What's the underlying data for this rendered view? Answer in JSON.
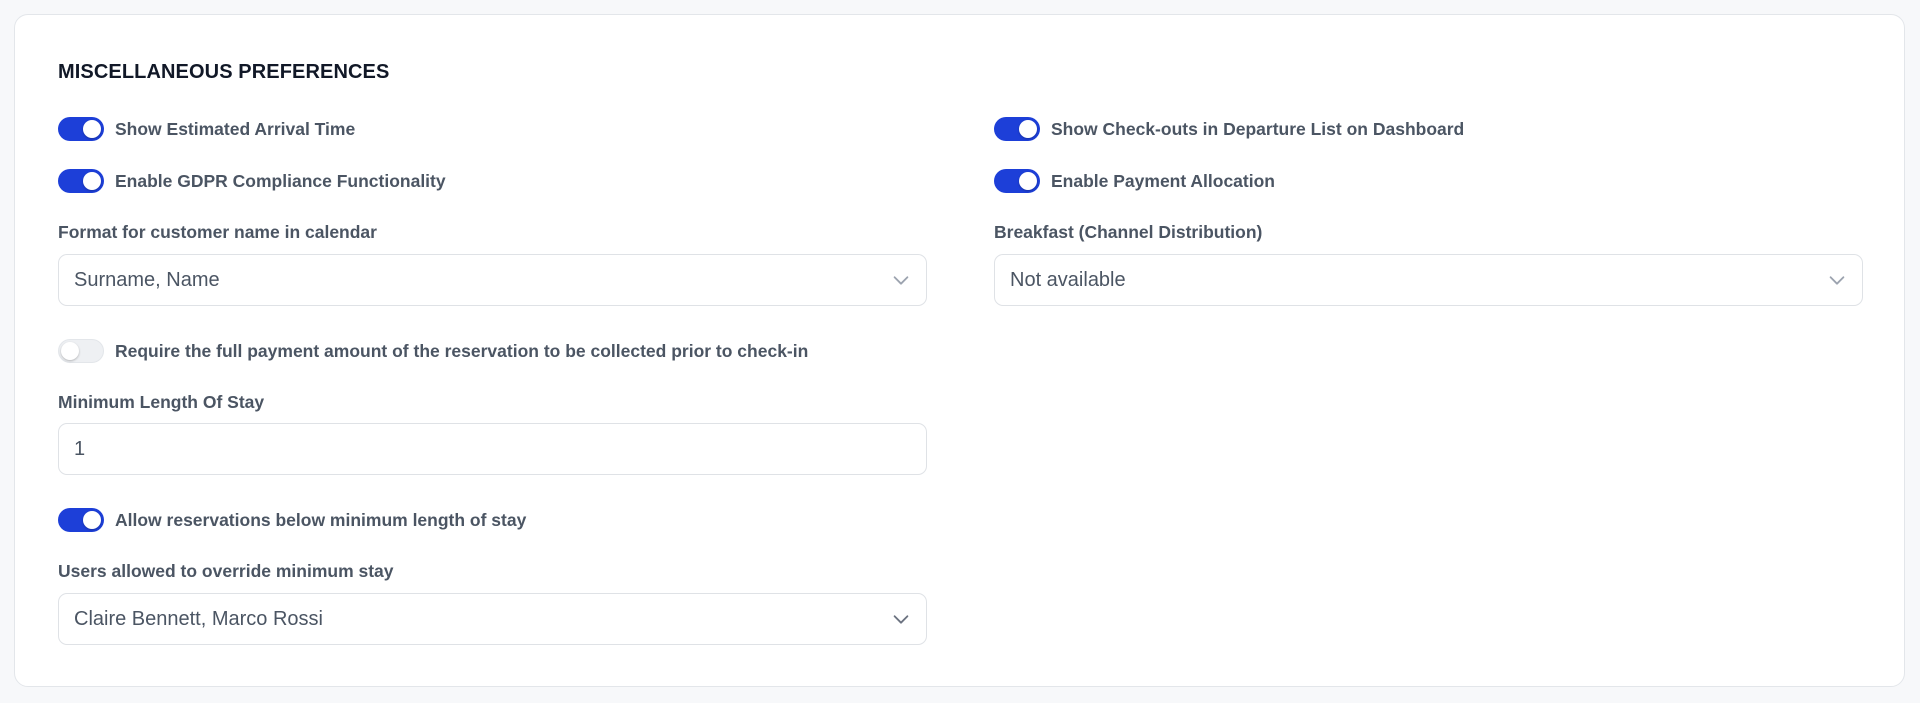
{
  "section": {
    "title": "MISCELLANEOUS PREFERENCES"
  },
  "toggles": {
    "estimated_arrival": {
      "label": "Show Estimated Arrival Time",
      "on": true
    },
    "checkouts_departure": {
      "label": "Show Check-outs in Departure List on Dashboard",
      "on": true
    },
    "gdpr": {
      "label": "Enable GDPR Compliance Functionality",
      "on": true
    },
    "payment_allocation": {
      "label": "Enable Payment Allocation",
      "on": true
    },
    "full_payment": {
      "label": "Require the full payment amount of the reservation to be collected prior to check-in",
      "on": false
    },
    "allow_below_min": {
      "label": "Allow reservations below minimum length of stay",
      "on": true
    }
  },
  "fields": {
    "customer_name_format": {
      "label": "Format for customer name in calendar",
      "value": "Surname, Name",
      "icon": "chevron-down-icon"
    },
    "breakfast": {
      "label": "Breakfast (Channel Distribution)",
      "value": "Not available",
      "icon": "chevron-down-icon"
    },
    "min_length_of_stay": {
      "label": "Minimum Length Of Stay",
      "value": "1"
    },
    "override_users": {
      "label": "Users allowed to override minimum stay",
      "value": "Claire Bennett, Marco Rossi",
      "icon": "chevron-down-icon"
    }
  },
  "colors": {
    "toggle_on": "#1d3fd8",
    "toggle_off": "#eef0f3",
    "label_text": "#4b5563",
    "title_text": "#111827",
    "chevron": "#9ca3af"
  }
}
